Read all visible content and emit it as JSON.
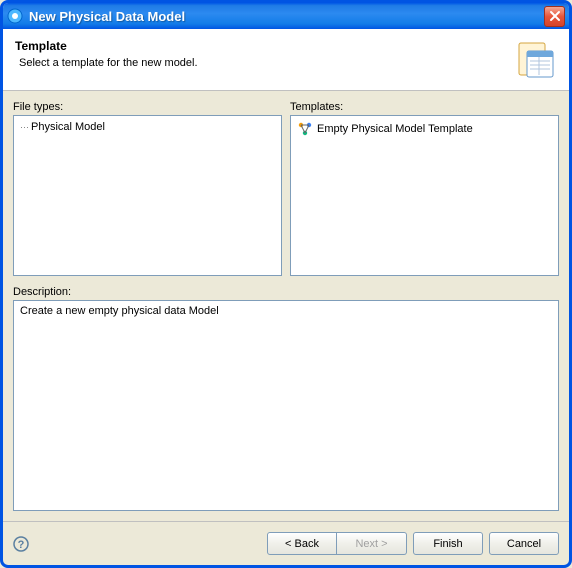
{
  "titlebar": {
    "title": "New Physical Data Model"
  },
  "header": {
    "title": "Template",
    "subtitle": "Select a template for the new model."
  },
  "labels": {
    "file_types": "File types:",
    "templates": "Templates:",
    "description": "Description:"
  },
  "file_types": {
    "items": [
      {
        "label": "Physical Model"
      }
    ]
  },
  "templates": {
    "items": [
      {
        "label": "Empty Physical Model Template"
      }
    ]
  },
  "description": {
    "value": "Create a new empty physical data Model"
  },
  "buttons": {
    "back": "< Back",
    "next": "Next >",
    "finish": "Finish",
    "cancel": "Cancel"
  }
}
